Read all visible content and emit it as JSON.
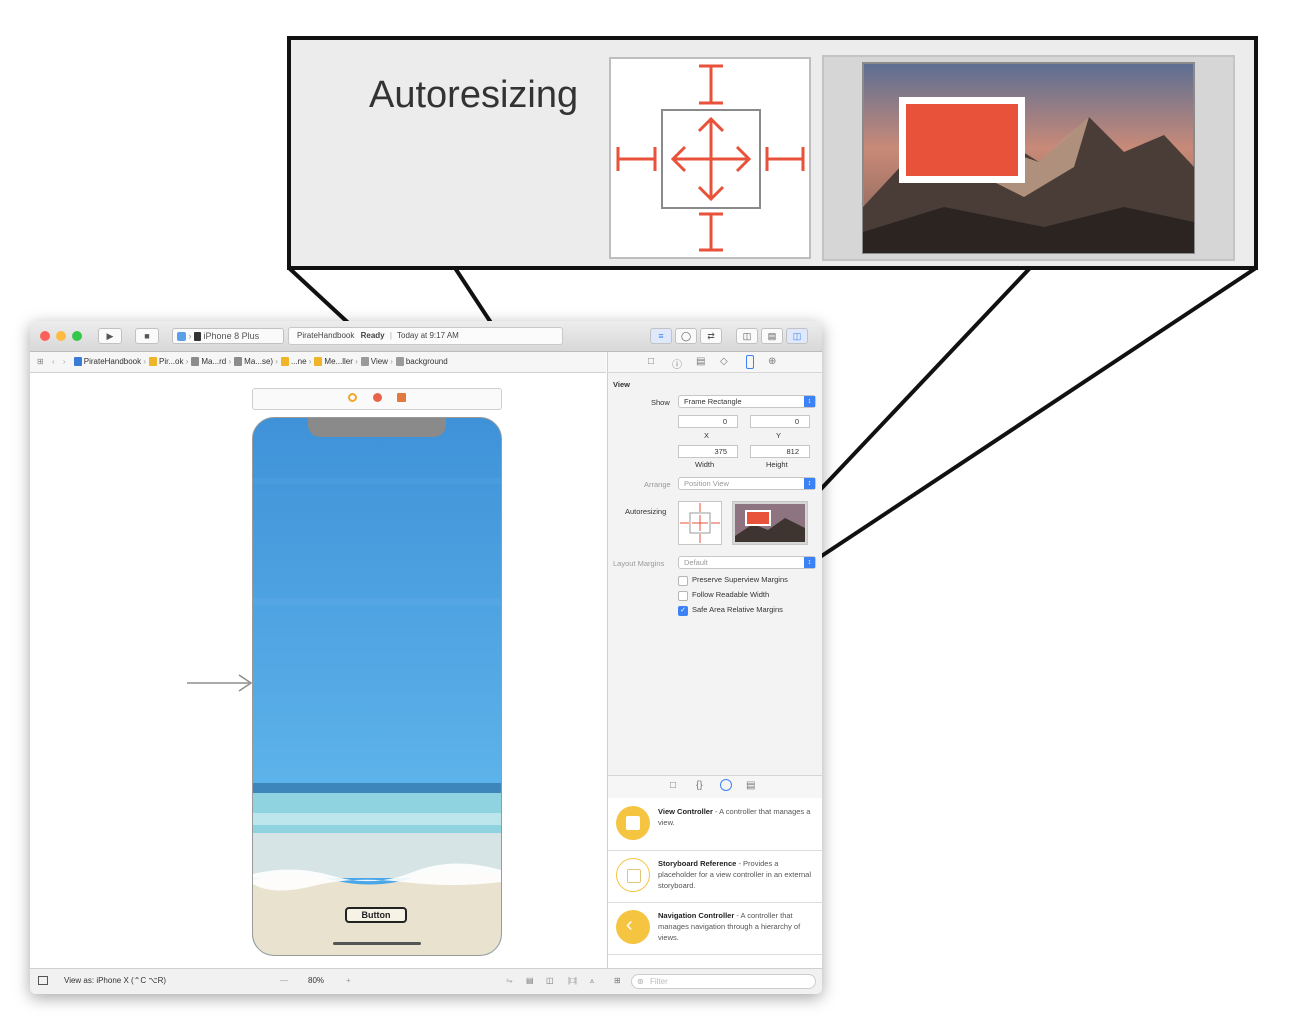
{
  "zoom": {
    "title": "Autoresizing"
  },
  "toolbar": {
    "scheme_target": "iPhone 8 Plus",
    "activity_project": "PirateHandbook",
    "activity_status": "Ready",
    "activity_time": "Today at 9:17 AM"
  },
  "breadcrumbs": [
    {
      "label": "PirateHandbook",
      "color": "#3a7bd5"
    },
    {
      "label": "Pir...ok",
      "color": "#f0b429"
    },
    {
      "label": "Ma...rd",
      "color": "#8c8c8c"
    },
    {
      "label": "Ma...se)",
      "color": "#8c8c8c"
    },
    {
      "label": "...ne",
      "color": "#f0b429"
    },
    {
      "label": "Me...ller",
      "color": "#f0b429"
    },
    {
      "label": "View",
      "color": "#9a9a9a"
    },
    {
      "label": "background",
      "color": "#9a9a9a"
    }
  ],
  "scene_dock": {
    "icons": [
      "view-controller-icon",
      "first-responder-icon",
      "exit-icon"
    ],
    "colors": [
      "#f2a62b",
      "#e8634a",
      "#e07a3f"
    ]
  },
  "device": {
    "button_label": "Button",
    "sky_color": "#4aa6e6",
    "sea_color": "#8fd3e0",
    "sand_color": "#e9e2cf"
  },
  "inspector": {
    "section_title": "View",
    "show_label": "Show",
    "show_value": "Frame Rectangle",
    "x_value": "0",
    "y_value": "0",
    "x_label": "X",
    "y_label": "Y",
    "width_value": "375",
    "height_value": "812",
    "width_label": "Width",
    "height_label": "Height",
    "arrange_label": "Arrange",
    "arrange_value": "Position View",
    "autoresizing_label": "Autoresizing",
    "layout_margins_label": "Layout Margins",
    "layout_margins_value": "Default",
    "checkboxes": [
      {
        "label": "Preserve Superview Margins",
        "checked": false
      },
      {
        "label": "Follow Readable Width",
        "checked": false
      },
      {
        "label": "Safe Area Relative Margins",
        "checked": true
      }
    ]
  },
  "library": {
    "items": [
      {
        "title": "View Controller",
        "desc": " - A controller that manages a view."
      },
      {
        "title": "Storyboard Reference",
        "desc": " - Provides a placeholder for a view controller in an external storyboard."
      },
      {
        "title": "Navigation Controller",
        "desc": " - A controller that manages navigation through a hierarchy of views."
      }
    ],
    "filter_placeholder": "Filter"
  },
  "bottombar": {
    "view_as": "View as: iPhone X (⌃C ⌥R)",
    "zoom_minus": "—",
    "zoom_value": "80%",
    "zoom_plus": "+"
  },
  "colors": {
    "accent_red": "#e8523a",
    "xcode_blue": "#3b82f6",
    "library_yellow": "#f5c542"
  }
}
